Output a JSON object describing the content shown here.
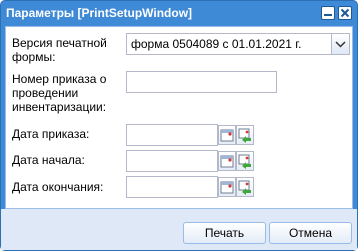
{
  "window": {
    "title": "Параметры [PrintSetupWindow]"
  },
  "form": {
    "version_label": "Версия печатной формы:",
    "version_value": "форма 0504089 с 01.01.2021 г.",
    "order_number_label": "Номер приказа о проведении инвентаризации:",
    "order_number_value": "",
    "order_date_label": "Дата приказа:",
    "order_date_value": "",
    "start_date_label": "Дата начала:",
    "start_date_value": "",
    "end_date_label": "Дата окончания:",
    "end_date_value": ""
  },
  "buttons": {
    "print_label": "Печать",
    "cancel_label": "Отмена"
  },
  "icons": {
    "minimize": "minimize-icon",
    "close": "close-icon",
    "dropdown": "chevron-down-icon",
    "calendar": "calendar-icon",
    "clear": "clear-date-icon"
  },
  "colors": {
    "title_bar": "#3f8ad6",
    "footer": "#dfe8f6",
    "field_border": "#b5b8c8"
  }
}
